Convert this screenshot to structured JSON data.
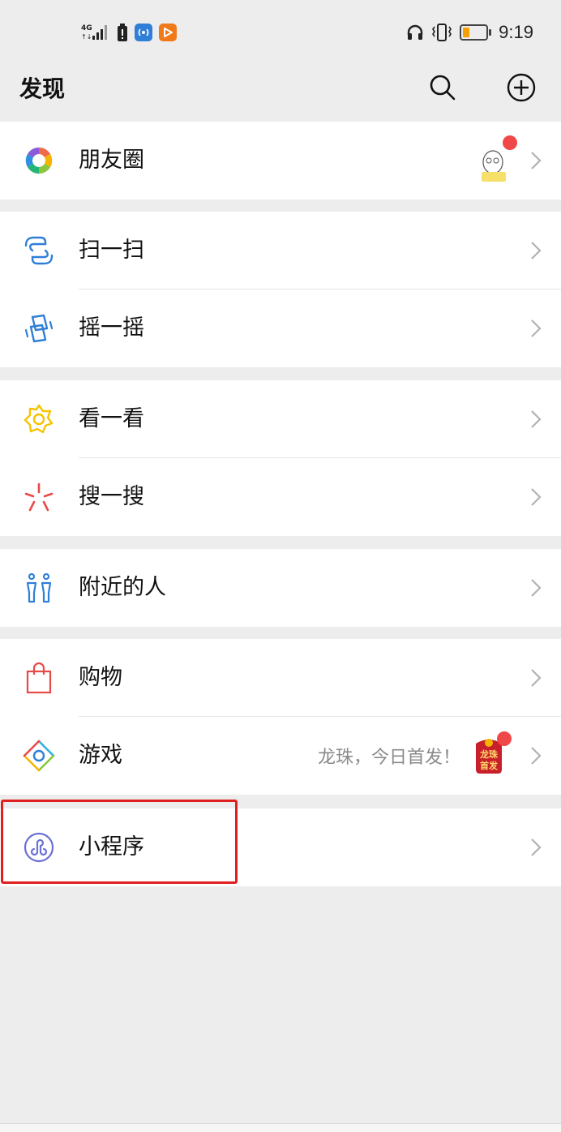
{
  "status_bar": {
    "network_label": "4G",
    "time": "9:19"
  },
  "header": {
    "title": "发现",
    "search_icon": "search-icon",
    "add_icon": "plus-circle-icon"
  },
  "menu": {
    "moments": {
      "label": "朋友圈",
      "icon": "aperture-icon",
      "has_new": true
    },
    "scan": {
      "label": "扫一扫",
      "icon": "scan-icon"
    },
    "shake": {
      "label": "摇一摇",
      "icon": "shake-icon"
    },
    "top_stories": {
      "label": "看一看",
      "icon": "star-icon"
    },
    "search": {
      "label": "搜一搜",
      "icon": "sparkle-icon"
    },
    "nearby": {
      "label": "附近的人",
      "icon": "people-icon"
    },
    "shopping": {
      "label": "购物",
      "icon": "shopping-bag-icon"
    },
    "games": {
      "label": "游戏",
      "icon": "diamond-icon",
      "promo_text": "龙珠，今日首发！",
      "badge_text_1": "龙珠",
      "badge_text_2": "首发",
      "has_new": true
    },
    "mini_programs": {
      "label": "小程序",
      "icon": "mini-program-icon"
    }
  },
  "colors": {
    "background": "#ededed",
    "highlight": "#e02020",
    "red_dot": "#f04848",
    "scan_blue": "#2f7fd8",
    "star_yellow": "#f5c400",
    "search_red": "#e84a4a",
    "mini_program_purple": "#6b6fd6"
  }
}
